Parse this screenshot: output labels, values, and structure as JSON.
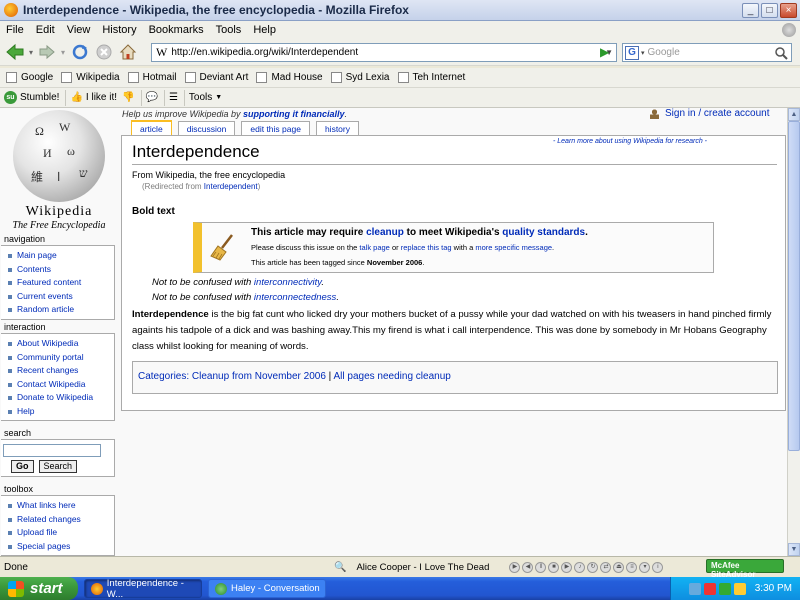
{
  "window": {
    "title": "Interdependence - Wikipedia, the free encyclopedia - Mozilla Firefox",
    "controls": [
      "_",
      "□",
      "×"
    ]
  },
  "menu": [
    "File",
    "Edit",
    "View",
    "History",
    "Bookmarks",
    "Tools",
    "Help"
  ],
  "nav": {
    "url": "http://en.wikipedia.org/wiki/Interdependent",
    "url_icon_letter": "W",
    "search_engine_letter": "G",
    "search_placeholder": "Google"
  },
  "bookmarks": [
    "Google",
    "Wikipedia",
    "Hotmail",
    "Deviant Art",
    "Mad House",
    "Syd Lexia",
    "Teh Internet"
  ],
  "toolbar2": {
    "stumble": "Stumble!",
    "like": "I like it!",
    "tools": "Tools"
  },
  "sitenotice": {
    "text": "Help us improve Wikipedia by",
    "link": "supporting it financially",
    "end": "."
  },
  "login": "Sign in / create account",
  "tabs": [
    "article",
    "discussion",
    "edit this page",
    "history"
  ],
  "logo": {
    "name": "Wikipedia",
    "tagline": "The Free Encyclopedia"
  },
  "sidebar": {
    "navigation": {
      "title": "navigation",
      "items": [
        "Main page",
        "Contents",
        "Featured content",
        "Current events",
        "Random article"
      ]
    },
    "interaction": {
      "title": "interaction",
      "items": [
        "About Wikipedia",
        "Community portal",
        "Recent changes",
        "Contact Wikipedia",
        "Donate to Wikipedia",
        "Help"
      ]
    },
    "search": {
      "title": "search",
      "go": "Go",
      "search": "Search"
    },
    "toolbox": {
      "title": "toolbox",
      "items": [
        "What links here",
        "Related changes",
        "Upload file",
        "Special pages"
      ]
    }
  },
  "article": {
    "learn_more": "- Learn more about using Wikipedia for research -",
    "title": "Interdependence",
    "from": "From Wikipedia, the free encyclopedia",
    "redirected_prefix": "(Redirected from ",
    "redirected_link": "Interdependent",
    "redirected_suffix": ")",
    "bold_text": "Bold text",
    "cleanup": {
      "line1_a": "This article may require ",
      "line1_link1": "cleanup",
      "line1_b": " to meet Wikipedia's ",
      "line1_link2": "quality standards",
      "line1_c": ".",
      "line2_a": "Please discuss this issue on the ",
      "line2_link1": "talk page",
      "line2_b": " or ",
      "line2_link2": "replace this tag",
      "line2_c": " with a ",
      "line2_link3": "more specific message",
      "line2_d": ".",
      "line3_a": "This article has been tagged since ",
      "line3_b": "November 2006",
      "line3_c": "."
    },
    "not_confused_1_prefix": "Not to be confused with ",
    "not_confused_1_link": "interconnectivity",
    "not_confused_2_prefix": "Not to be confused with ",
    "not_confused_2_link": "interconnectedness",
    "period": ".",
    "body_bold": "Interdependence",
    "body_text": " is the big fat cunt who licked dry your mothers bucket of a pussy while your dad watched on with his tweasers in hand pinched firmly againts his tadpole of a dick and was bashing away.This my firend is what i call interpendence. This was done by somebody in Mr Hobans Geography class whilst looking for meaning of words.",
    "categories_label": "Categories",
    "categories_colon": ": ",
    "category1": "Cleanup from November 2006",
    "category_sep": " | ",
    "category2": "All pages needing cleanup"
  },
  "status": {
    "done": "Done",
    "song": "Alice Cooper - I Love The Dead",
    "mcafee": "McAfee SiteAdvisor"
  },
  "taskbar": {
    "start": "start",
    "task1": "Interdependence - W...",
    "task2": "Haley - Conversation",
    "clock": "3:30 PM"
  },
  "colors": {
    "link": "#002bb8",
    "cleanup_bar": "#f2c12d",
    "tab_selected": "#fabd23",
    "taskbar": "#245edb",
    "start": "#3c9a3c"
  }
}
